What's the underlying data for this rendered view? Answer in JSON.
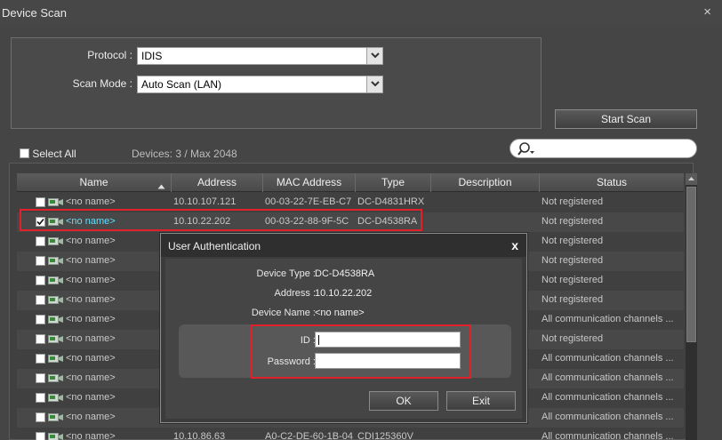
{
  "window": {
    "title": "Device Scan",
    "close_glyph": "×"
  },
  "settings": {
    "protocol_label": "Protocol :",
    "protocol_value": "IDIS",
    "scan_mode_label": "Scan Mode :",
    "scan_mode_value": "Auto Scan (LAN)",
    "start_scan": "Start Scan"
  },
  "toolbar": {
    "select_all": "Select All",
    "device_count": "Devices: 3 / Max 2048",
    "search_value": ""
  },
  "table": {
    "columns": [
      "Name",
      "Address",
      "MAC Address",
      "Type",
      "Description",
      "Status"
    ],
    "rows": [
      {
        "name": "<no name>",
        "address": "10.10.107.121",
        "mac": "00-03-22-7E-EB-C7",
        "type": "DC-D4831HRX",
        "status": "Not registered",
        "checked": false
      },
      {
        "name": "<no name>",
        "address": "10.10.22.202",
        "mac": "00-03-22-88-9F-5C",
        "type": "DC-D4538RA",
        "status": "Not registered",
        "checked": true
      },
      {
        "name": "<no name>",
        "address": "",
        "mac": "",
        "type": "",
        "status": "Not registered",
        "checked": false
      },
      {
        "name": "<no name>",
        "address": "",
        "mac": "",
        "type": "",
        "status": "Not registered",
        "checked": false
      },
      {
        "name": "<no name>",
        "address": "",
        "mac": "",
        "type": "",
        "status": "Not registered",
        "checked": false
      },
      {
        "name": "<no name>",
        "address": "",
        "mac": "",
        "type": "",
        "status": "Not registered",
        "checked": false
      },
      {
        "name": "<no name>",
        "address": "",
        "mac": "",
        "type": "",
        "status": "All communication channels ...",
        "checked": false
      },
      {
        "name": "<no name>",
        "address": "",
        "mac": "",
        "type": "",
        "status": "Not registered",
        "checked": false
      },
      {
        "name": "<no name>",
        "address": "",
        "mac": "",
        "type": "",
        "status": "All communication channels ...",
        "checked": false
      },
      {
        "name": "<no name>",
        "address": "",
        "mac": "",
        "type": "",
        "status": "All communication channels ...",
        "checked": false
      },
      {
        "name": "<no name>",
        "address": "",
        "mac": "",
        "type": "",
        "status": "All communication channels ...",
        "checked": false
      },
      {
        "name": "<no name>",
        "address": "",
        "mac": "",
        "type": "",
        "status": "All communication channels ...",
        "checked": false
      },
      {
        "name": "<no name>",
        "address": "10.10.86.63",
        "mac": "A0-C2-DE-60-1B-04",
        "type": "CDI125360V",
        "status": "All communication channels ...",
        "checked": false
      }
    ]
  },
  "dialog": {
    "title": "User Authentication",
    "close_glyph": "x",
    "device_type_label": "Device Type :",
    "device_type_value": "DC-D4538RA",
    "address_label": "Address :",
    "address_value": "10.10.22.202",
    "device_name_label": "Device Name :",
    "device_name_value": "<no name>",
    "id_label": "ID :",
    "id_value": "",
    "password_label": "Password :",
    "password_value": "",
    "ok": "OK",
    "exit": "Exit"
  },
  "colors": {
    "highlight": "#e0202a",
    "selected_name": "#5fe0ff"
  },
  "icons": [
    "close-icon",
    "dropdown-arrow-icon",
    "search-icon",
    "sort-asc-icon",
    "device-icon",
    "checkbox"
  ]
}
